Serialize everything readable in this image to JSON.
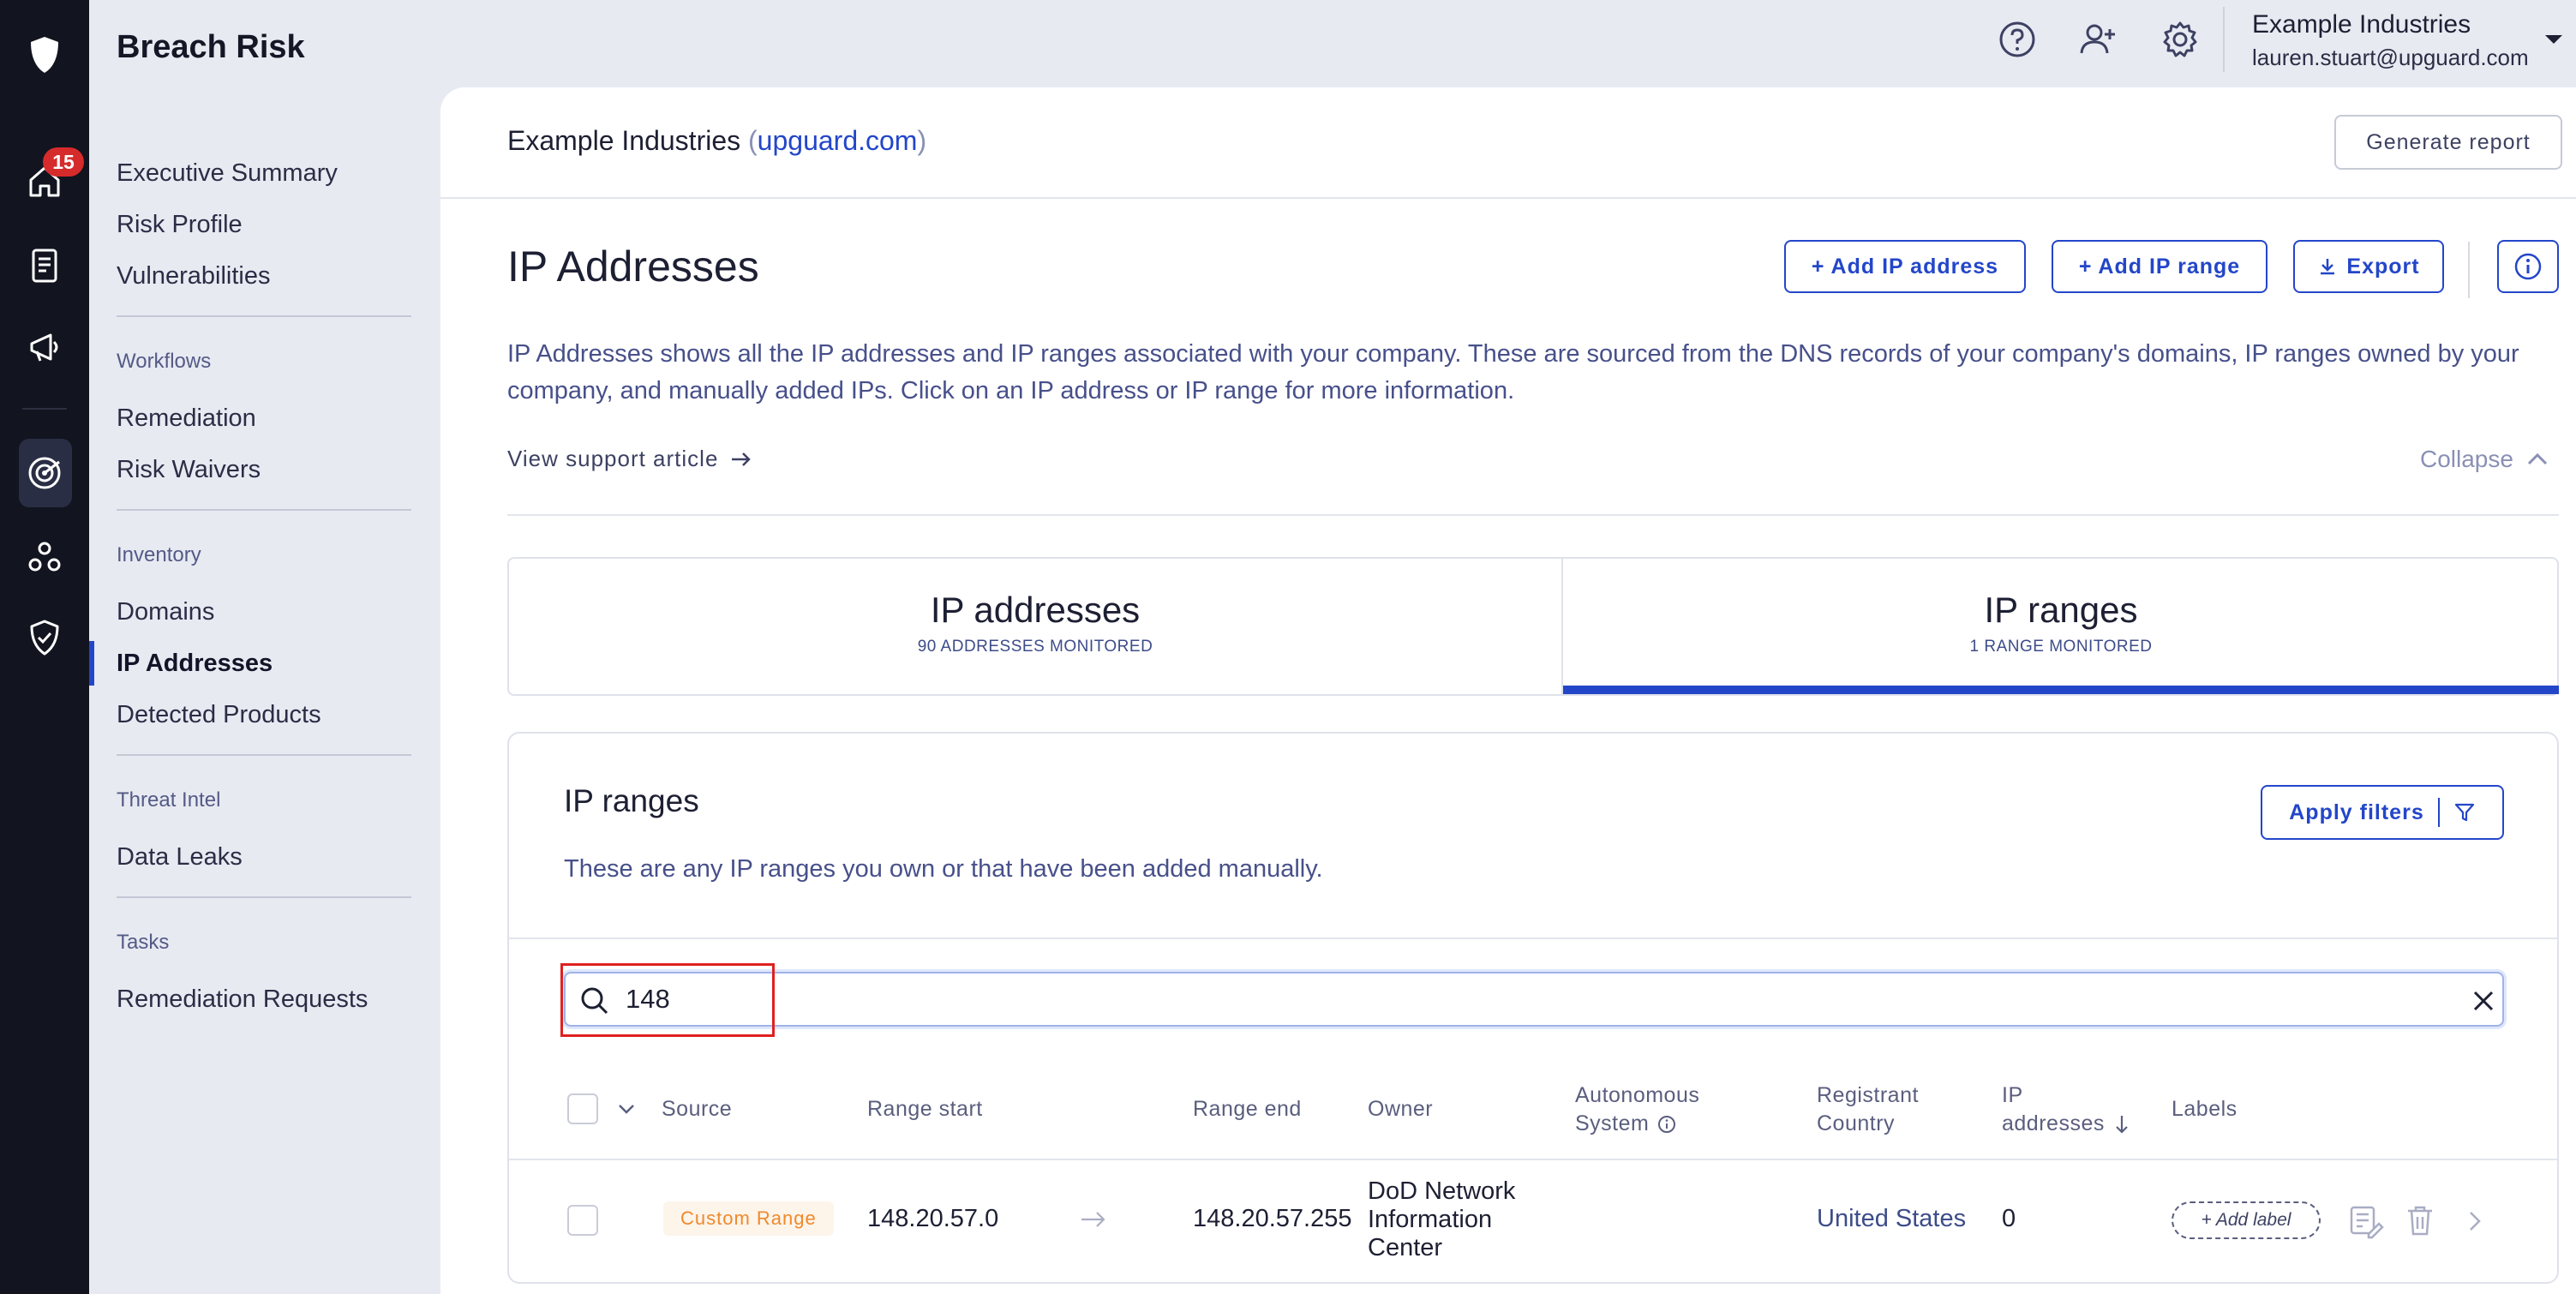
{
  "app": {
    "title": "Breach Risk",
    "notification_count": "15"
  },
  "user": {
    "org": "Example Industries",
    "email": "lauren.stuart@upguard.com"
  },
  "sidebar": {
    "group1": [
      "Executive Summary",
      "Risk Profile",
      "Vulnerabilities"
    ],
    "workflows": {
      "heading": "Workflows",
      "items": [
        "Remediation",
        "Risk Waivers"
      ]
    },
    "inventory": {
      "heading": "Inventory",
      "items": [
        "Domains",
        "IP Addresses",
        "Detected Products"
      ]
    },
    "threat": {
      "heading": "Threat Intel",
      "items": [
        "Data Leaks"
      ]
    },
    "tasks": {
      "heading": "Tasks",
      "items": [
        "Remediation Requests"
      ]
    }
  },
  "header": {
    "company": "Example Industries",
    "domain": "upguard.com",
    "open_paren": "(",
    "close_paren": ")",
    "generate_report": "Generate report"
  },
  "page": {
    "title": "IP Addresses",
    "add_ip": "+ Add IP address",
    "add_range": "+ Add IP range",
    "export": "Export",
    "description": "IP Addresses shows all the IP addresses and IP ranges associated with your company. These are sourced from the DNS records of your company's domains, IP ranges owned by your company, and manually added IPs. Click on an IP address or IP range for more information.",
    "support_link": "View support article",
    "collapse": "Collapse"
  },
  "tabs": [
    {
      "title": "IP addresses",
      "sub": "90 ADDRESSES MONITORED"
    },
    {
      "title": "IP ranges",
      "sub": "1 RANGE MONITORED"
    }
  ],
  "ranges": {
    "title": "IP ranges",
    "description": "These are any IP ranges you own or that have been added manually.",
    "apply_filters": "Apply filters",
    "search_value": "148"
  },
  "table": {
    "headers": {
      "source": "Source",
      "range_start": "Range start",
      "range_end": "Range end",
      "owner": "Owner",
      "as_line1": "Autonomous",
      "as_line2": "System",
      "country_line1": "Registrant",
      "country_line2": "Country",
      "ips_line1": "IP",
      "ips_line2": "addresses",
      "labels": "Labels"
    },
    "rows": [
      {
        "source": "Custom Range",
        "range_start": "148.20.57.0",
        "range_end": "148.20.57.255",
        "owner_line1": "DoD Network",
        "owner_line2": "Information",
        "owner_line3": "Center",
        "country": "United States",
        "ip_count": "0",
        "add_label": "+ Add label"
      }
    ]
  },
  "colors": {
    "accent": "#2346c9",
    "rail": "#12141f",
    "badge": "#d62b2b",
    "source_tag": "#f0892b"
  }
}
